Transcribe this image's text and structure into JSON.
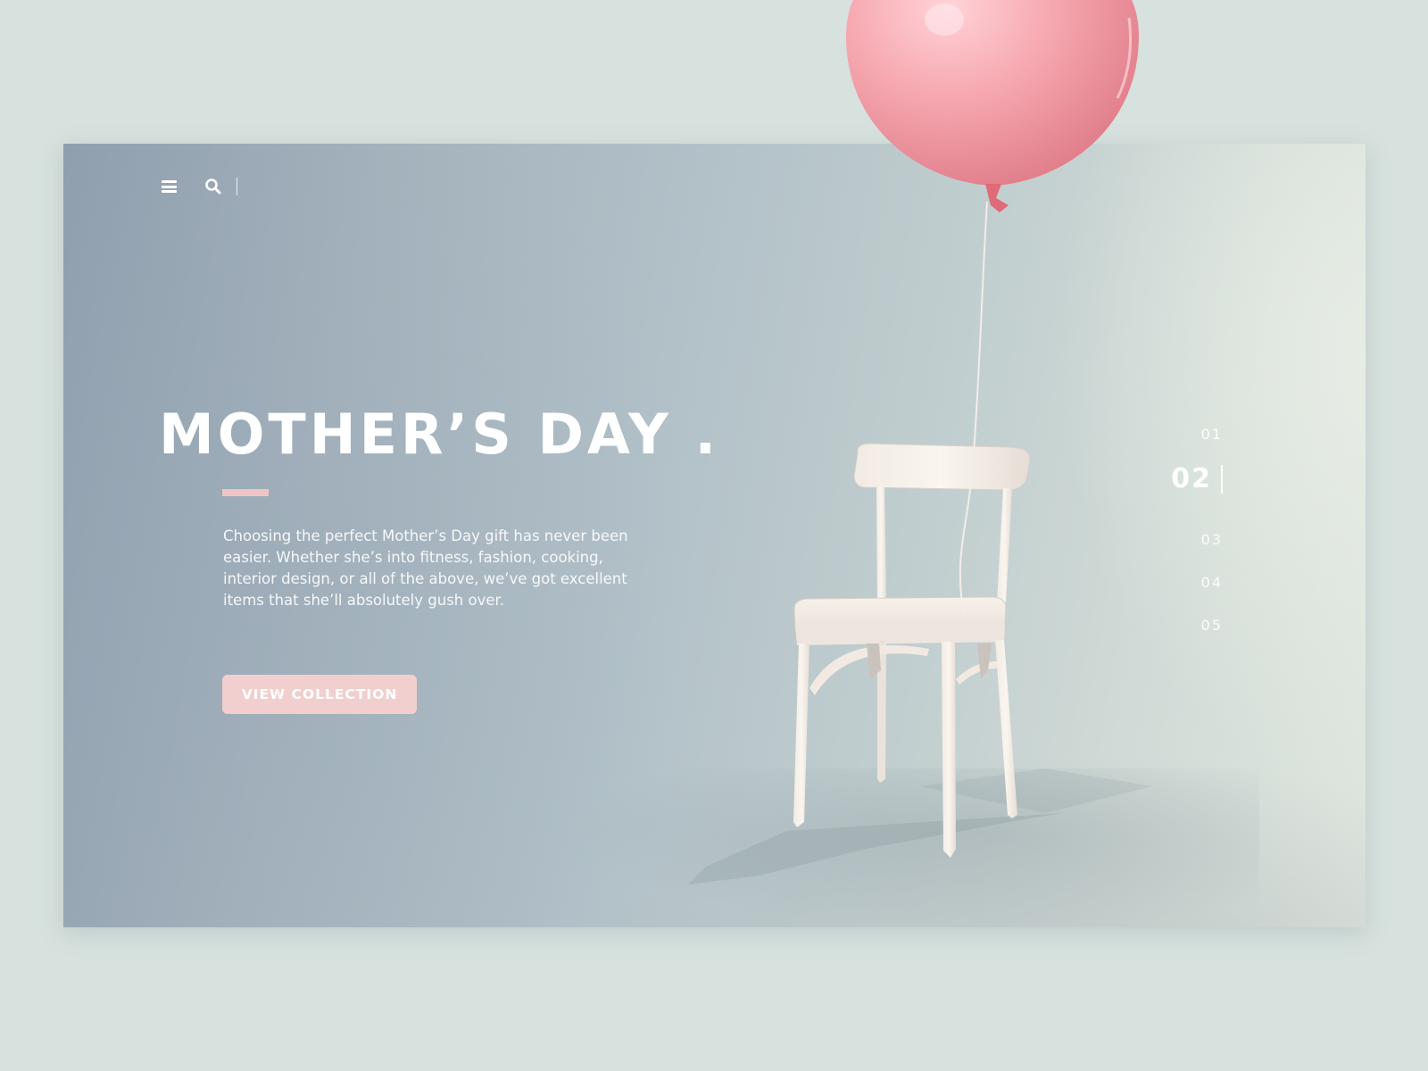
{
  "toolbar": {
    "menu_icon": "menu-icon",
    "search_icon": "search-icon"
  },
  "hero": {
    "title": "MOTHER’S DAY .",
    "description": "Choosing the perfect Mother’s Day gift has never been easier. Whether she’s into fitness, fashion, cooking, interior design, or all of the above, we’ve got excellent items that she’ll absolutely gush over.",
    "cta_label": "VIEW COLLECTION",
    "accent_color": "#f0c4c4"
  },
  "pager": {
    "items": [
      "01",
      "02",
      "03",
      "04",
      "05"
    ],
    "active_index": 1
  },
  "colors": {
    "page_background": "#d7e1de",
    "balloon": "#f3a0a6",
    "button": "#f1cfcf"
  }
}
